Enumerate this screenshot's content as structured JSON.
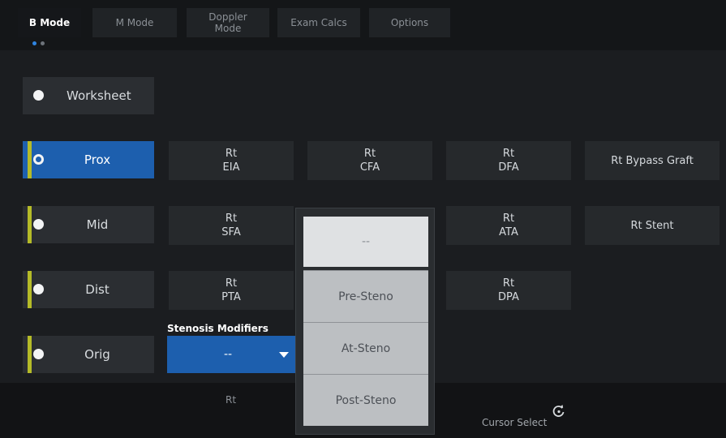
{
  "tabs": [
    {
      "label": "B Mode",
      "active": true
    },
    {
      "label": "M Mode",
      "active": false
    },
    {
      "label": "Doppler\nMode",
      "active": false
    },
    {
      "label": "Exam Calcs",
      "active": false
    },
    {
      "label": "Options",
      "active": false
    }
  ],
  "left_buttons": {
    "worksheet": "Worksheet",
    "prox": "Prox",
    "mid": "Mid",
    "dist": "Dist",
    "orig": "Orig"
  },
  "grid": {
    "rt_eia": {
      "side": "Rt",
      "name": "EIA"
    },
    "rt_cfa": {
      "side": "Rt",
      "name": "CFA"
    },
    "rt_dfa": {
      "side": "Rt",
      "name": "DFA"
    },
    "rt_bypass_graft": "Rt Bypass Graft",
    "rt_sfa": {
      "side": "Rt",
      "name": "SFA"
    },
    "rt_ata": {
      "side": "Rt",
      "name": "ATA"
    },
    "rt_stent": "Rt Stent",
    "rt_pta": {
      "side": "Rt",
      "name": "PTA"
    },
    "rt_dpa": {
      "side": "Rt",
      "name": "DPA"
    }
  },
  "stenosis": {
    "label": "Stenosis Modifiers",
    "selected": "--"
  },
  "dropdown": {
    "options": [
      "--",
      "Pre-Steno",
      "At-Steno",
      "Post-Steno"
    ]
  },
  "bottom": {
    "rt_label": "Rt",
    "cursor_select": "Cursor Select"
  },
  "icons": {
    "radio": "radio-button-icon",
    "caret": "chevron-down-icon",
    "rotate": "rotate-knob-icon"
  },
  "colors": {
    "active_blue": "#1d5fae",
    "accent_yellow": "#b5bb28",
    "page_indicator": "#2f84e0"
  }
}
